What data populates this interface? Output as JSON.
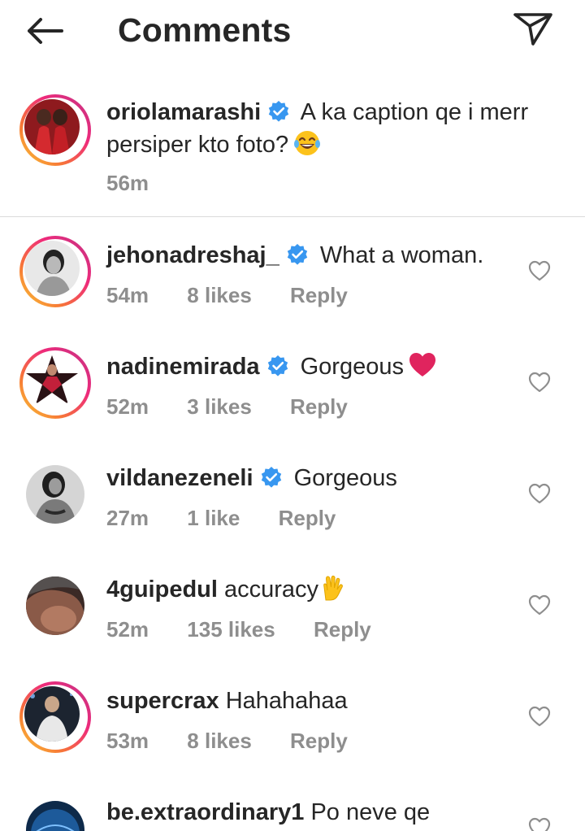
{
  "header": {
    "title": "Comments",
    "back_icon": "arrow-left-icon",
    "share_icon": "paper-plane-icon"
  },
  "caption": {
    "username": "oriolamarashi",
    "verified": true,
    "text": "A ka caption qe i merr persiper kto foto?",
    "emoji": "tears-of-joy-emoji",
    "time": "56m"
  },
  "comments": [
    {
      "username": "jehonadreshaj_",
      "verified": true,
      "text": "What a woman.",
      "time": "54m",
      "likes": "8 likes",
      "reply": "Reply"
    },
    {
      "username": "nadinemirada",
      "verified": true,
      "text": "Gorgeous",
      "emoji": "red-heart-emoji",
      "time": "52m",
      "likes": "3 likes",
      "reply": "Reply"
    },
    {
      "username": "vildanezeneli",
      "verified": true,
      "text": "Gorgeous",
      "time": "27m",
      "likes": "1 like",
      "reply": "Reply"
    },
    {
      "username": "4guipedul",
      "verified": false,
      "text": "accuracy",
      "emoji": "vulcan-salute-emoji",
      "time": "52m",
      "likes": "135 likes",
      "reply": "Reply"
    },
    {
      "username": "supercrax",
      "verified": false,
      "text": "Hahahahaa",
      "time": "53m",
      "likes": "8 likes",
      "reply": "Reply"
    },
    {
      "username": "be.extraordinary1",
      "verified": false,
      "text": "Po neve qe"
    }
  ],
  "colors": {
    "verified": "#3897f0",
    "text": "#262626",
    "meta": "#8e8e8e",
    "heart_emoji": "#e0245e"
  }
}
